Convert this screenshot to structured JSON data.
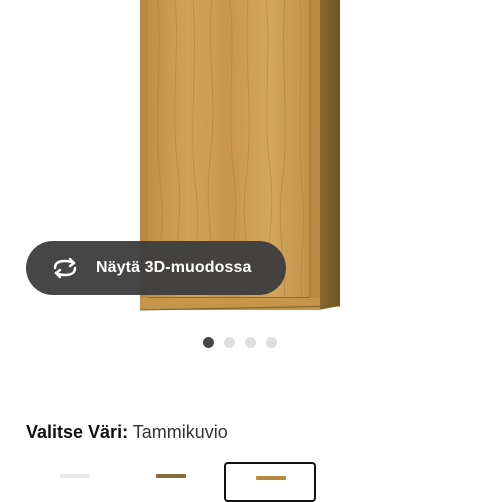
{
  "view_3d": {
    "label": "Näytä 3D-muodossa",
    "icon": "rotate-3d-icon"
  },
  "carousel": {
    "total": 4,
    "active_index": 0
  },
  "color_selector": {
    "label": "Valitse Väri:",
    "selected_value": "Tammikuvio",
    "swatches": [
      {
        "name": "white",
        "color": "#e9e9e9"
      },
      {
        "name": "walnut",
        "color": "#8a6c3c"
      },
      {
        "name": "oak",
        "color": "#b7893f",
        "selected": true
      }
    ]
  },
  "colors": {
    "button_bg": "#3e3e3e",
    "dot_active": "#484848",
    "dot_inactive": "#dfdfdf",
    "wood": "#c99a4c"
  }
}
